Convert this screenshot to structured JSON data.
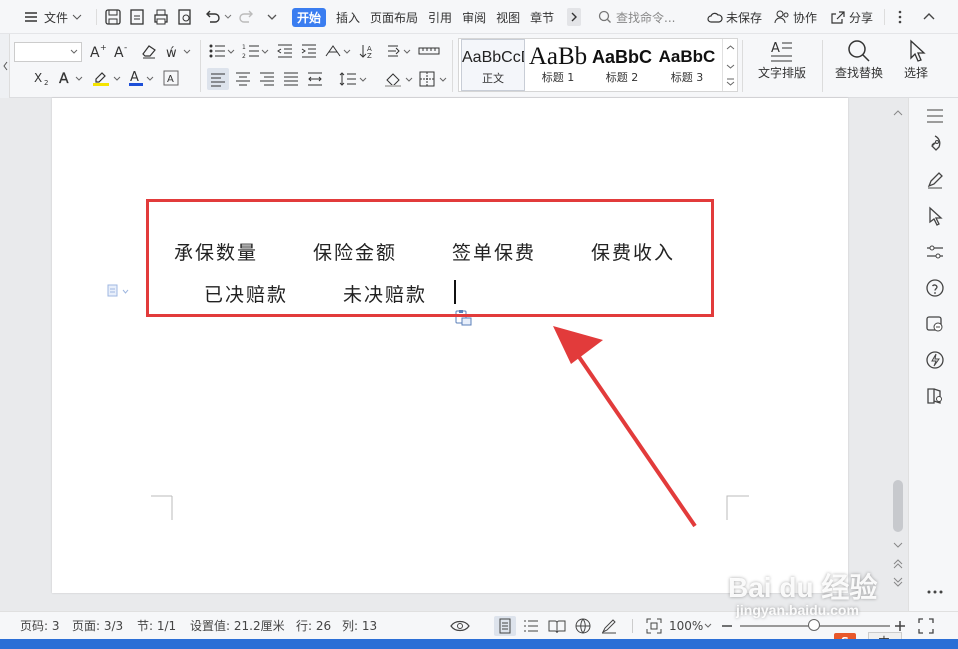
{
  "menu": {
    "file_label": "文件",
    "tabs": [
      "开始",
      "插入",
      "页面布局",
      "引用",
      "审阅",
      "视图",
      "章节"
    ],
    "search_placeholder": "查找命令...",
    "unsaved": "未保存",
    "collaborate": "协作",
    "share": "分享"
  },
  "ribbon": {
    "styles": [
      {
        "preview": "AaBbCcDd",
        "name": "正文"
      },
      {
        "preview": "AaBb",
        "name": "标题 1"
      },
      {
        "preview": "AaBbC",
        "name": "标题 2"
      },
      {
        "preview": "AaBbC",
        "name": "标题 3"
      }
    ],
    "text_layout": "文字排版",
    "find_replace": "查找替换",
    "select": "选择"
  },
  "document": {
    "line1": [
      "承保数量",
      "保险金额",
      "签单保费",
      "保费收入"
    ],
    "line2": [
      "已决赔款",
      "未决赔款"
    ]
  },
  "status": {
    "page_code": "页码: 3",
    "page": "页面: 3/3",
    "section": "节: 1/1",
    "setting": "设置值: 21.2厘米",
    "row": "行: 26",
    "col": "列: 13",
    "zoom": "100%"
  },
  "watermark": {
    "logo": "Bai du 经验",
    "url": "jingyan.baidu.com"
  },
  "colors": {
    "accent": "#3a7df0",
    "highlight_box": "#e23b3b"
  }
}
